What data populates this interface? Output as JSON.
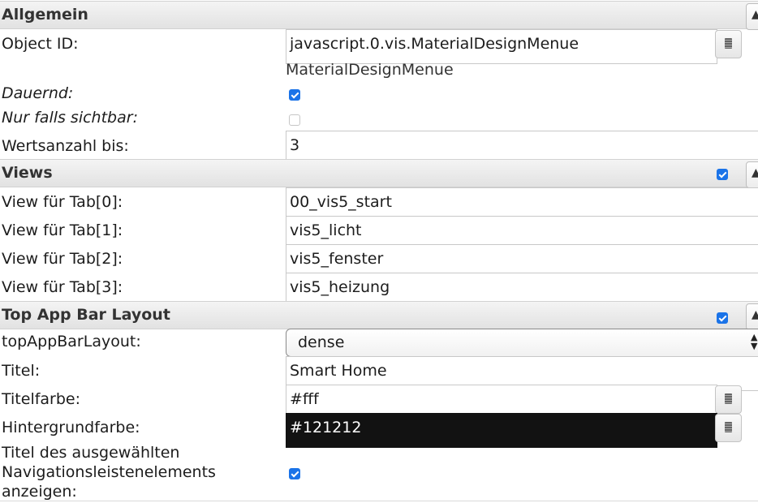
{
  "sections": {
    "general": {
      "title": "Allgemein",
      "collapse_icon": "▲"
    },
    "views": {
      "title": "Views",
      "enabled": true,
      "collapse_icon": "▲"
    },
    "topbar": {
      "title": "Top App Bar Layout",
      "enabled": true,
      "collapse_icon": "▲"
    }
  },
  "general": {
    "object_id": {
      "label": "Object ID:",
      "value": "javascript.0.vis.MaterialDesignMenue",
      "hint": "MaterialDesignMenue"
    },
    "dauernd": {
      "label": "Dauernd:",
      "checked": true
    },
    "nur_falls_sichtbar": {
      "label": "Nur falls sichtbar:",
      "checked": false
    },
    "wertsanzahl": {
      "label": "Wertsanzahl bis:",
      "value": "3"
    }
  },
  "views": {
    "items": [
      {
        "label": "View für Tab[0]:",
        "value": "00_vis5_start"
      },
      {
        "label": "View für Tab[1]:",
        "value": "vis5_licht"
      },
      {
        "label": "View für Tab[2]:",
        "value": "vis5_fenster"
      },
      {
        "label": "View für Tab[3]:",
        "value": "vis5_heizung"
      }
    ]
  },
  "topbar": {
    "layout": {
      "label": "topAppBarLayout:",
      "selected": "dense",
      "arrows": "▲▼"
    },
    "titel": {
      "label": "Titel:",
      "value": "Smart Home"
    },
    "titelfarbe": {
      "label": "Titelfarbe:",
      "value": "#fff"
    },
    "hintergrundfarbe": {
      "label": "Hintergrundfarbe:",
      "value": "#121212"
    },
    "show_selected_title": {
      "label_lines": [
        "Titel des ausgewählten",
        "Navigationsleistenelements",
        "anzeigen:"
      ],
      "checked": true
    }
  },
  "icons": {
    "collapse": "chevron-up-icon",
    "picker": "color-picker-icon",
    "select_arrows": "select-updown-icon"
  },
  "colors": {
    "checkbox_accent": "#1a73e8",
    "header_bg": "#e8e8e8",
    "dark_field_bg": "#121212"
  }
}
